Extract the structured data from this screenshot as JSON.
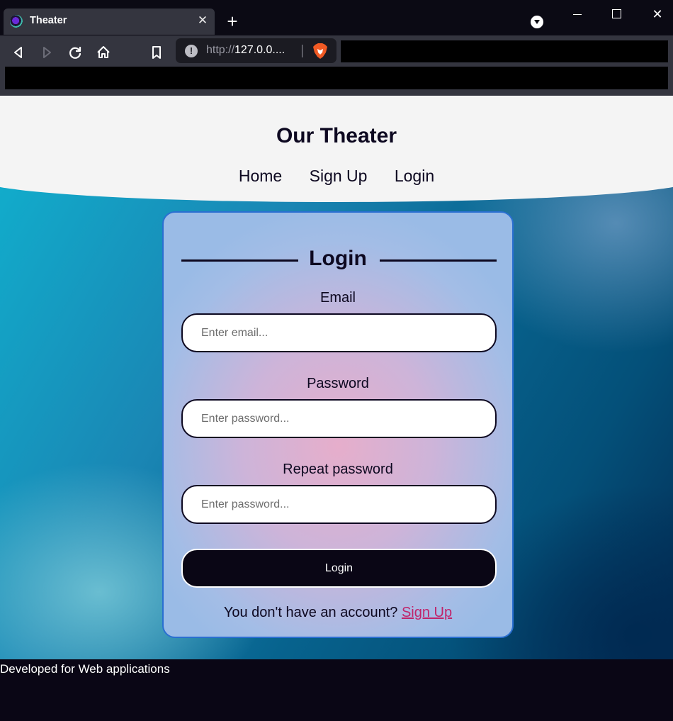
{
  "browser": {
    "tab_title": "Theater",
    "tab_close": "✕",
    "new_tab": "+",
    "url_scheme": "http://",
    "url_host": "127.0.0....",
    "icons": [
      "back-icon",
      "forward-icon",
      "reload-icon",
      "home-icon",
      "bookmark-icon",
      "site-info-icon",
      "brave-shield-icon"
    ]
  },
  "site": {
    "title": "Our Theater",
    "nav": [
      "Home",
      "Sign Up",
      "Login"
    ]
  },
  "login_form": {
    "heading": "Login",
    "email_label": "Email",
    "email_placeholder": "Enter email...",
    "password_label": "Password",
    "password_placeholder": "Enter password...",
    "repeat_label": "Repeat password",
    "repeat_placeholder": "Enter password...",
    "submit_label": "Login",
    "switch_text": "You don't have an account? ",
    "switch_link": "Sign Up"
  },
  "footer": {
    "text": "Developed for Web applications"
  },
  "colors": {
    "header_bg": "#f4f4f4",
    "footer_bg": "#0a0615",
    "card_border": "#2a6fd1",
    "link": "#c0246a"
  }
}
